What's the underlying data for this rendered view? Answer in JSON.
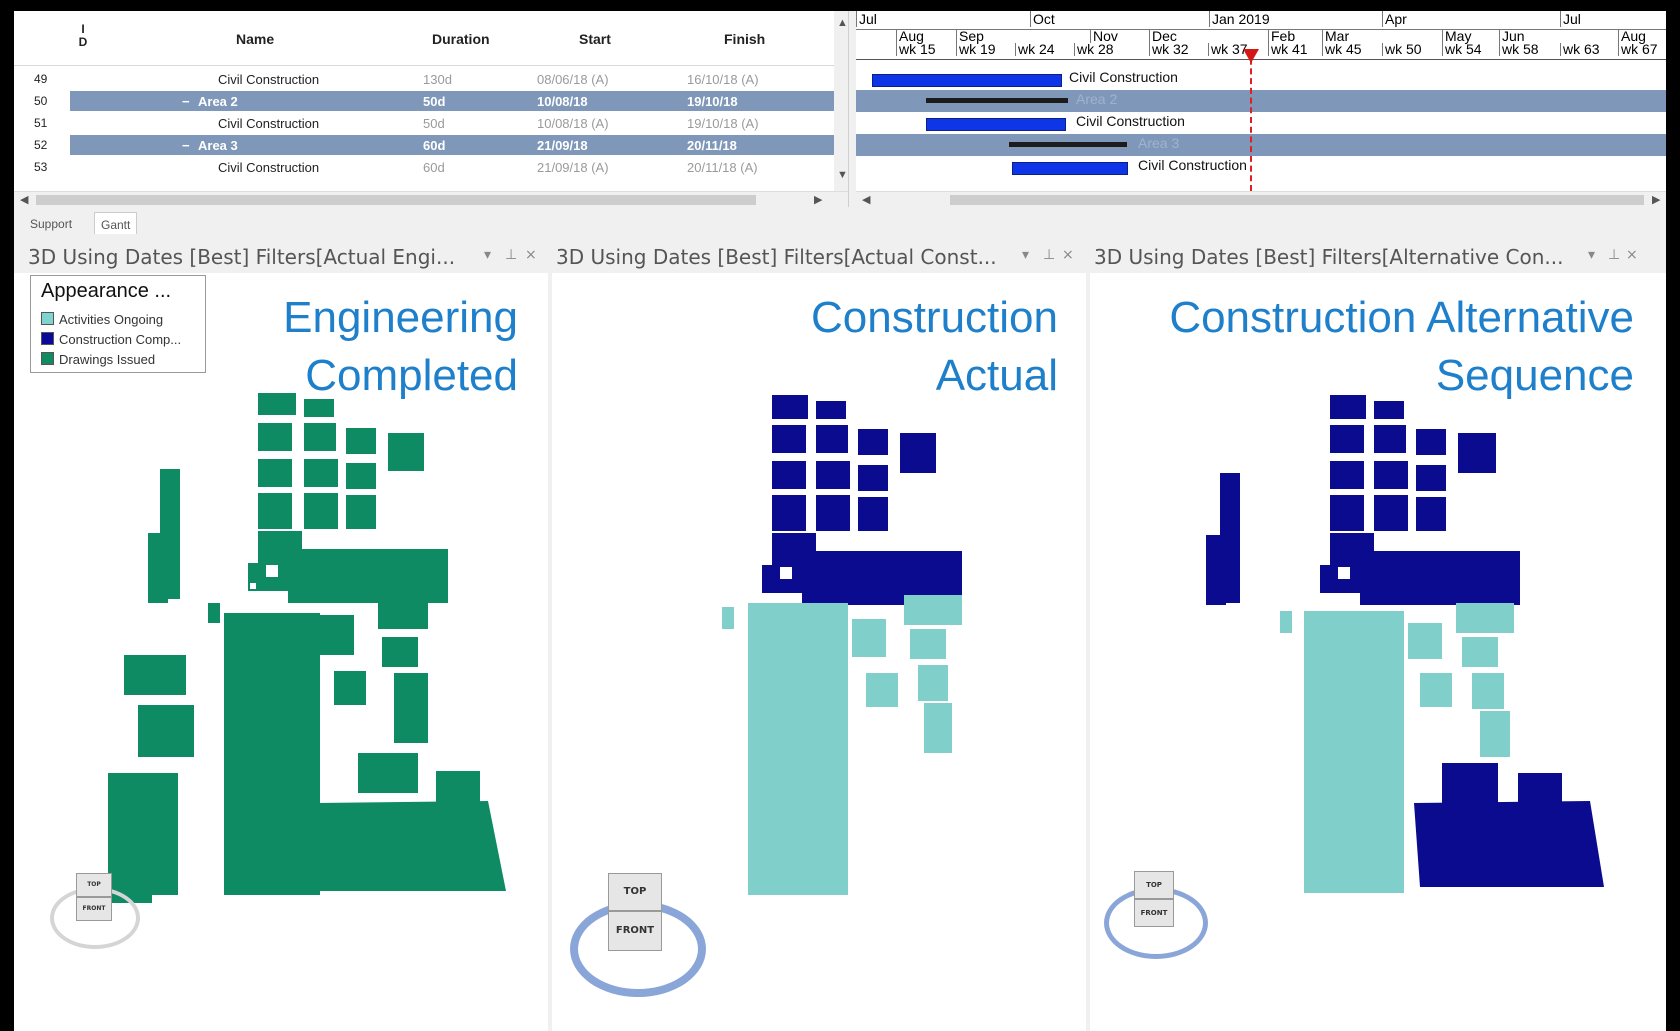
{
  "gantt_table": {
    "columns": {
      "id": "I D",
      "name": "Name",
      "duration": "Duration",
      "start": "Start",
      "finish": "Finish"
    },
    "rows": [
      {
        "id": "49",
        "name": "Civil Construction",
        "duration": "130d",
        "start": "08/06/18 (A)",
        "finish": "16/10/18 (A)",
        "summary": false
      },
      {
        "id": "50",
        "name": "Area 2",
        "duration": "50d",
        "start": "10/08/18",
        "finish": "19/10/18",
        "summary": true
      },
      {
        "id": "51",
        "name": "Civil Construction",
        "duration": "50d",
        "start": "10/08/18 (A)",
        "finish": "19/10/18 (A)",
        "summary": false
      },
      {
        "id": "52",
        "name": "Area 3",
        "duration": "60d",
        "start": "21/09/18",
        "finish": "20/11/18",
        "summary": true
      },
      {
        "id": "53",
        "name": "Civil Construction",
        "duration": "60d",
        "start": "21/09/18 (A)",
        "finish": "20/11/18 (A)",
        "summary": false
      }
    ]
  },
  "timeline": {
    "months": [
      "Jul",
      "Oct",
      "Jan 2019",
      "Apr",
      "Jul"
    ],
    "sub_months": [
      "Aug",
      "Sep",
      "Nov",
      "Dec",
      "Feb",
      "Mar",
      "May",
      "Jun",
      "Aug"
    ],
    "weeks": [
      "wk 15",
      "wk 19",
      "wk 24",
      "wk 28",
      "wk 32",
      "wk 37",
      "wk 41",
      "wk 45",
      "wk 50",
      "wk 54",
      "wk 58",
      "wk 63",
      "wk 67"
    ],
    "bar_labels": [
      "Civil Construction",
      "Area 2",
      "Civil Construction",
      "Area 3",
      "Civil Construction"
    ]
  },
  "tabs": [
    "Support",
    "Gantt"
  ],
  "views": [
    {
      "header": "3D Using Dates [Best] Filters[Actual Engi...",
      "title_line1": "Engineering",
      "title_line2": "Completed"
    },
    {
      "header": "3D Using Dates [Best] Filters[Actual Const...",
      "title_line1": "Construction",
      "title_line2": "Actual"
    },
    {
      "header": "3D Using Dates [Best] Filters[Alternative Con...",
      "title_line1": "Construction Alternative",
      "title_line2": "Sequence"
    }
  ],
  "legend": {
    "title": "Appearance ...",
    "items": [
      {
        "label": "Activities Ongoing",
        "color": "#7fd3d0"
      },
      {
        "label": "Construction Comp...",
        "color": "#0a0a9a"
      },
      {
        "label": "Drawings Issued",
        "color": "#118a5f"
      }
    ]
  },
  "navcube": {
    "top": "TOP",
    "front": "FRONT"
  },
  "colors": {
    "engineering": "#0f8b63",
    "completed": "#0b0b8f",
    "ongoing": "#80cfcb",
    "title_blue": "#1e7fcb",
    "summary_row": "#7f98b9",
    "bar": "#0e36e6"
  }
}
